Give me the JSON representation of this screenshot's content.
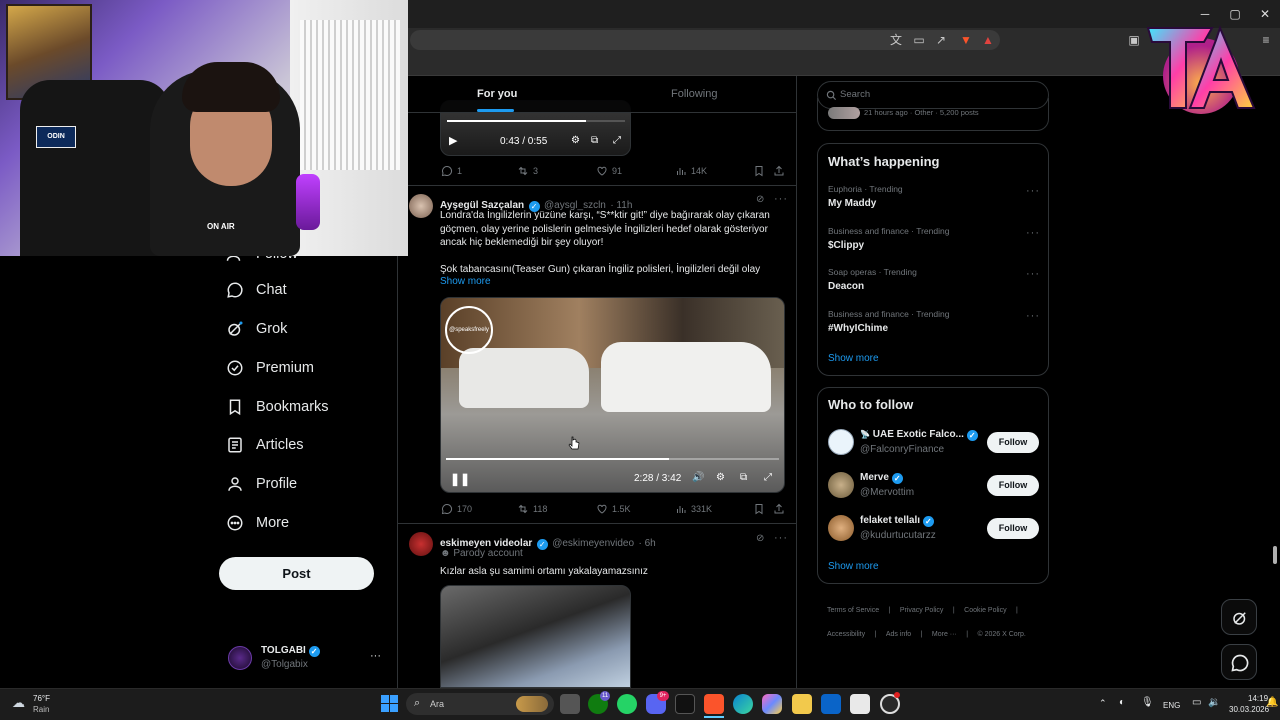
{
  "timeline": {
    "tabs": [
      {
        "label": "For you",
        "active": true
      },
      {
        "label": "Following",
        "active": false
      }
    ],
    "top_video": {
      "time": "0:43 / 0:55",
      "progress": 0.78
    },
    "top_actions": {
      "replies": "1",
      "reposts": "3",
      "likes": "91",
      "views": "14K"
    },
    "tweets": [
      {
        "name": "Ayşegül Sazçalan",
        "handle": "@aysgl_szcln",
        "time": "· 11h",
        "text_line1": "Londra'da İngilizlerin yüzüne karşı, “S**ktir git!” diye bağırarak olay çıkaran",
        "text_line2": "göçmen, olay yerine polislerin gelmesiyle İngilizleri hedef olarak gösteriyor",
        "text_line3": "ancak hiç beklemediği bir şey oluyor!",
        "text_line4": "Şok tabancasını(Teaser Gun) çıkaran İngiliz polisleri, İngilizleri değil olay",
        "show_more": "Show more",
        "watermark": "@speaksfreely",
        "video_time": "2:28 / 3:42",
        "video_progress": 0.67,
        "actions": {
          "replies": "170",
          "reposts": "118",
          "likes": "1.5K",
          "views": "331K"
        }
      },
      {
        "name": "eskimeyen videolar",
        "handle": "@eskimeyenvideo",
        "time": "· 6h",
        "label": "Parody account",
        "text_line1": "Kızlar asla şu samimi ortamı yakalayamazsınız"
      }
    ]
  },
  "sidebar": {
    "items": [
      {
        "label": "Follow",
        "icon": "person-plus-icon"
      },
      {
        "label": "Chat",
        "icon": "chat-bubble-icon"
      },
      {
        "label": "Grok",
        "icon": "grok-icon"
      },
      {
        "label": "Premium",
        "icon": "verified-badge-icon"
      },
      {
        "label": "Bookmarks",
        "icon": "bookmark-icon"
      },
      {
        "label": "Articles",
        "icon": "article-icon"
      },
      {
        "label": "Profile",
        "icon": "person-icon"
      },
      {
        "label": "More",
        "icon": "more-circle-icon"
      }
    ],
    "post_label": "Post",
    "account": {
      "name": "TOLGABI",
      "handle": "@Tolgabix",
      "menu": "···"
    }
  },
  "right": {
    "search_placeholder": "Search",
    "top_snippet": "21 hours ago · Other · 5,200 posts",
    "whats_happening": {
      "title": "What’s happening",
      "trends": [
        {
          "meta": "Euphoria · Trending",
          "name": "My Maddy"
        },
        {
          "meta": "Business and finance · Trending",
          "name": "$Clippy"
        },
        {
          "meta": "Soap operas · Trending",
          "name": "Deacon"
        },
        {
          "meta": "Business and finance · Trending",
          "name": "#WhyIChime"
        }
      ],
      "show_more": "Show more"
    },
    "who_to_follow": {
      "title": "Who to follow",
      "accounts": [
        {
          "name": "UAE Exotic Falco...",
          "prefix": "📡",
          "handle": "@FalconryFinance",
          "button": "Follow"
        },
        {
          "name": "Merve",
          "prefix": "",
          "handle": "@Mervottim",
          "button": "Follow"
        },
        {
          "name": "felaket tellalı",
          "prefix": "",
          "handle": "@kudurtucutarzz",
          "button": "Follow"
        }
      ],
      "show_more": "Show more"
    },
    "footer": {
      "row1": [
        "Terms of Service",
        "Privacy Policy",
        "Cookie Policy"
      ],
      "row2": [
        "Accessibility",
        "Ads info",
        "More ···",
        "© 2026 X Corp."
      ]
    }
  },
  "taskbar": {
    "weather": {
      "temp": "76°F",
      "condition": "Rain"
    },
    "search_placeholder": "Ara",
    "lang": "ENG",
    "time": "14:19",
    "date": "30.03.2026",
    "badges": {
      "xbox": "11",
      "discord": "9+"
    }
  },
  "webcam": {
    "pillow_text": "ODIN",
    "shirt_text": "ON AIR"
  },
  "colors": {
    "accent": "#1d9bf0",
    "background": "#000000",
    "border": "#2f3336",
    "muted": "#71767b"
  }
}
